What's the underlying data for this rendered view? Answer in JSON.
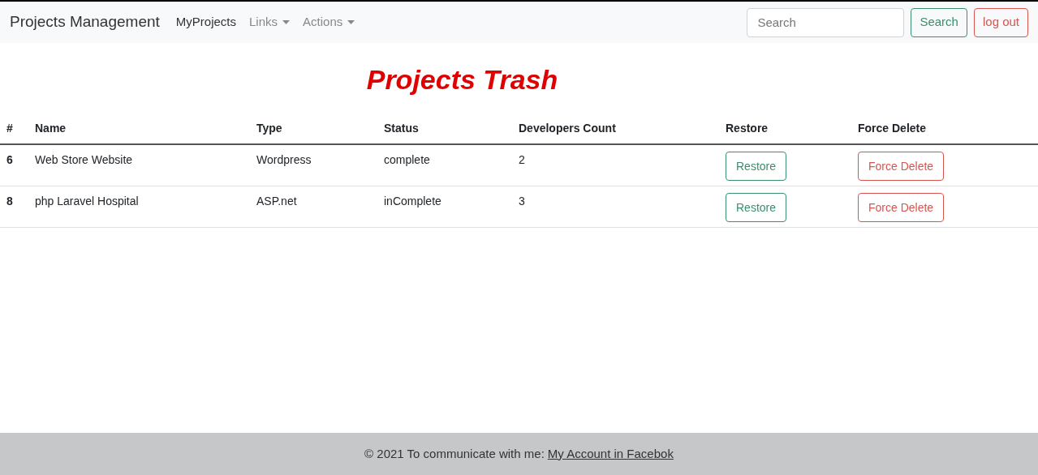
{
  "navbar": {
    "brand": "Projects Management",
    "items": [
      {
        "label": "MyProjects",
        "selected": true,
        "dropdown": false
      },
      {
        "label": "Links",
        "selected": false,
        "dropdown": true
      },
      {
        "label": "Actions",
        "selected": false,
        "dropdown": true
      }
    ],
    "search": {
      "placeholder": "Search",
      "button": "Search"
    },
    "logout": "log out"
  },
  "title": "Projects Trash",
  "table": {
    "columns": [
      "#",
      "Name",
      "Type",
      "Status",
      "Developers Count",
      "Restore",
      "Force Delete"
    ],
    "rows": [
      {
        "id": "6",
        "name": "Web Store Website",
        "type": "Wordpress",
        "status": "complete",
        "developers": "2",
        "restore": "Restore",
        "force_delete": "Force Delete"
      },
      {
        "id": "8",
        "name": "php Laravel Hospital",
        "type": "ASP.net",
        "status": "inComplete",
        "developers": "3",
        "restore": "Restore",
        "force_delete": "Force Delete"
      }
    ]
  },
  "footer": {
    "text": "© 2021 To communicate with me:",
    "link": "My Account in Facebok"
  }
}
